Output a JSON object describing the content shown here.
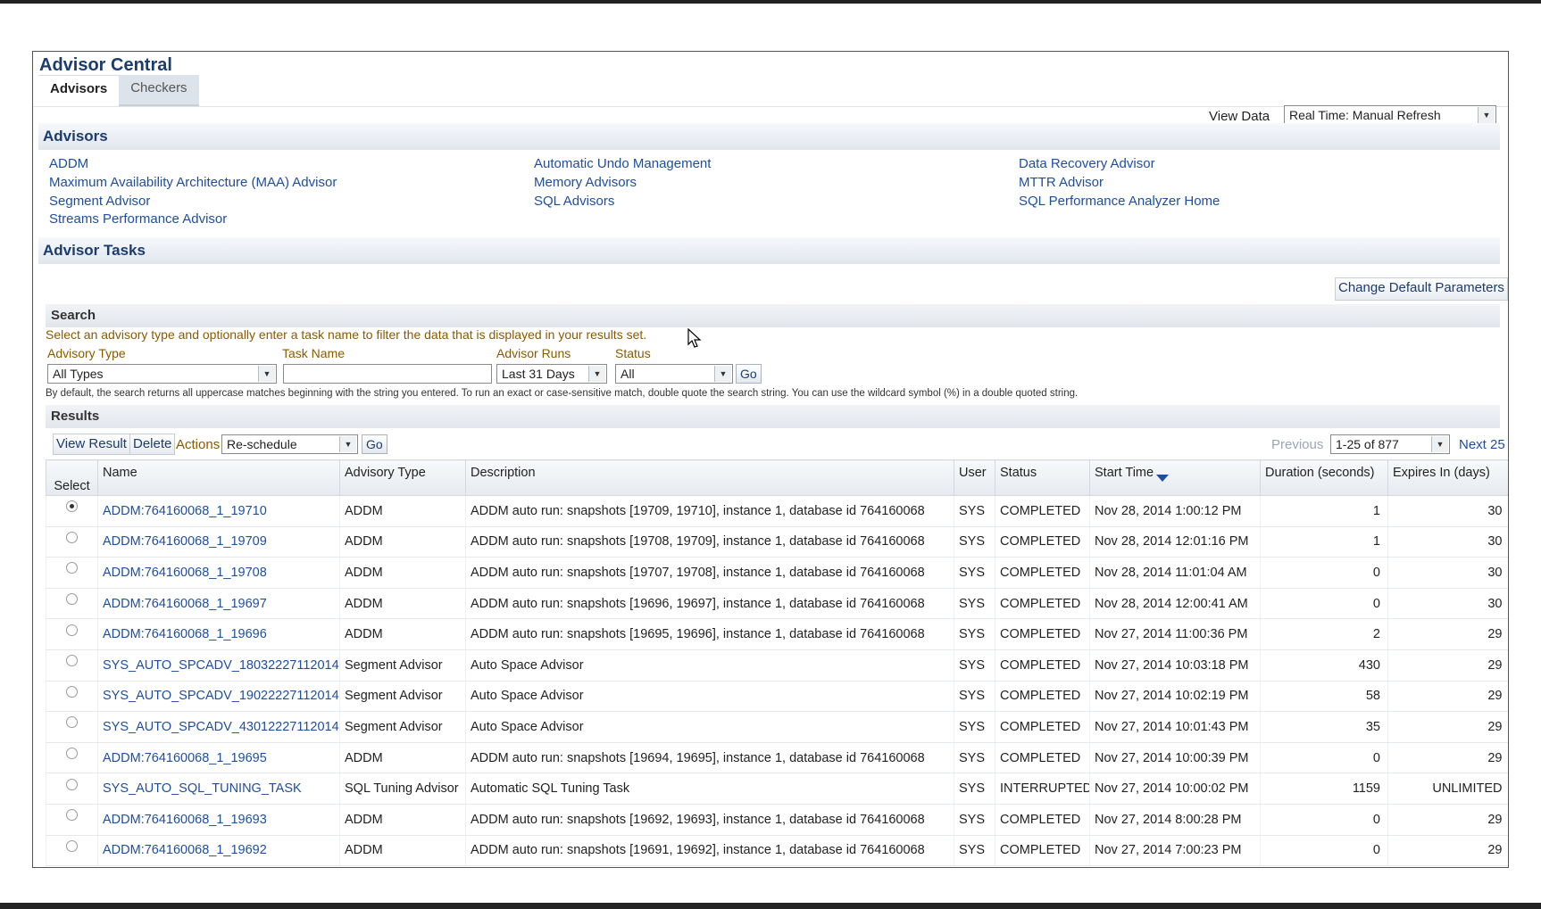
{
  "app": {
    "title": "Advisor Central"
  },
  "tabs": [
    {
      "label": "Advisors",
      "active": true
    },
    {
      "label": "Checkers",
      "active": false
    }
  ],
  "view_data": {
    "label": "View Data",
    "value": "Real Time: Manual Refresh"
  },
  "advisors_section": {
    "title": "Advisors",
    "columns": [
      [
        "ADDM",
        "Maximum Availability Architecture (MAA) Advisor",
        "Segment Advisor",
        "Streams Performance Advisor"
      ],
      [
        "Automatic Undo Management",
        "Memory Advisors",
        "SQL Advisors"
      ],
      [
        "Data Recovery Advisor",
        "MTTR Advisor",
        "SQL Performance Analyzer Home"
      ]
    ]
  },
  "tasks_section": {
    "title": "Advisor Tasks",
    "change_default_button": "Change Default Parameters"
  },
  "search": {
    "title": "Search",
    "instruction": "Select an advisory type and optionally enter a task name to filter the data that is displayed in your results set.",
    "advisory_type": {
      "label": "Advisory Type",
      "value": "All Types"
    },
    "task_name": {
      "label": "Task Name",
      "value": ""
    },
    "advisor_runs": {
      "label": "Advisor Runs",
      "value": "Last 31 Days"
    },
    "status": {
      "label": "Status",
      "value": "All"
    },
    "go_label": "Go",
    "hint": "By default, the search returns all uppercase matches beginning with the string you entered. To run an exact or case-sensitive match, double quote the search string. You can use the wildcard symbol (%) in a double quoted string."
  },
  "results": {
    "title": "Results",
    "view_result_button": "View Result",
    "delete_button": "Delete",
    "actions_label": "Actions",
    "actions_value": "Re-schedule",
    "go_label": "Go",
    "previous_label": "Previous",
    "range_value": "1-25 of 877",
    "next_label": "Next 25",
    "columns": [
      "Select",
      "Name",
      "Advisory Type",
      "Description",
      "User",
      "Status",
      "Start Time",
      "Duration (seconds)",
      "Expires In (days)"
    ],
    "rows": [
      {
        "selected": true,
        "name": "ADDM:764160068_1_19710",
        "type": "ADDM",
        "description": "ADDM auto run: snapshots [19709, 19710], instance 1, database id 764160068",
        "user": "SYS",
        "status": "COMPLETED",
        "start": "Nov 28, 2014 1:00:12 PM",
        "duration": "1",
        "expires": "30"
      },
      {
        "selected": false,
        "name": "ADDM:764160068_1_19709",
        "type": "ADDM",
        "description": "ADDM auto run: snapshots [19708, 19709], instance 1, database id 764160068",
        "user": "SYS",
        "status": "COMPLETED",
        "start": "Nov 28, 2014 12:01:16 PM",
        "duration": "1",
        "expires": "30"
      },
      {
        "selected": false,
        "name": "ADDM:764160068_1_19708",
        "type": "ADDM",
        "description": "ADDM auto run: snapshots [19707, 19708], instance 1, database id 764160068",
        "user": "SYS",
        "status": "COMPLETED",
        "start": "Nov 28, 2014 11:01:04 AM",
        "duration": "0",
        "expires": "30"
      },
      {
        "selected": false,
        "name": "ADDM:764160068_1_19697",
        "type": "ADDM",
        "description": "ADDM auto run: snapshots [19696, 19697], instance 1, database id 764160068",
        "user": "SYS",
        "status": "COMPLETED",
        "start": "Nov 28, 2014 12:00:41 AM",
        "duration": "0",
        "expires": "30"
      },
      {
        "selected": false,
        "name": "ADDM:764160068_1_19696",
        "type": "ADDM",
        "description": "ADDM auto run: snapshots [19695, 19696], instance 1, database id 764160068",
        "user": "SYS",
        "status": "COMPLETED",
        "start": "Nov 27, 2014 11:00:36 PM",
        "duration": "2",
        "expires": "29"
      },
      {
        "selected": false,
        "name": "SYS_AUTO_SPCADV_18032227112014",
        "type": "Segment Advisor",
        "description": "Auto Space Advisor",
        "user": "SYS",
        "status": "COMPLETED",
        "start": "Nov 27, 2014 10:03:18 PM",
        "duration": "430",
        "expires": "29"
      },
      {
        "selected": false,
        "name": "SYS_AUTO_SPCADV_19022227112014",
        "type": "Segment Advisor",
        "description": "Auto Space Advisor",
        "user": "SYS",
        "status": "COMPLETED",
        "start": "Nov 27, 2014 10:02:19 PM",
        "duration": "58",
        "expires": "29"
      },
      {
        "selected": false,
        "name": "SYS_AUTO_SPCADV_43012227112014",
        "type": "Segment Advisor",
        "description": "Auto Space Advisor",
        "user": "SYS",
        "status": "COMPLETED",
        "start": "Nov 27, 2014 10:01:43 PM",
        "duration": "35",
        "expires": "29"
      },
      {
        "selected": false,
        "name": "ADDM:764160068_1_19695",
        "type": "ADDM",
        "description": "ADDM auto run: snapshots [19694, 19695], instance 1, database id 764160068",
        "user": "SYS",
        "status": "COMPLETED",
        "start": "Nov 27, 2014 10:00:39 PM",
        "duration": "0",
        "expires": "29"
      },
      {
        "selected": false,
        "name": "SYS_AUTO_SQL_TUNING_TASK",
        "type": "SQL Tuning Advisor",
        "description": "Automatic SQL Tuning Task",
        "user": "SYS",
        "status": "INTERRUPTED",
        "start": "Nov 27, 2014 10:00:02 PM",
        "duration": "1159",
        "expires": "UNLIMITED"
      },
      {
        "selected": false,
        "name": "ADDM:764160068_1_19693",
        "type": "ADDM",
        "description": "ADDM auto run: snapshots [19692, 19693], instance 1, database id 764160068",
        "user": "SYS",
        "status": "COMPLETED",
        "start": "Nov 27, 2014 8:00:28 PM",
        "duration": "0",
        "expires": "29"
      },
      {
        "selected": false,
        "name": "ADDM:764160068_1_19692",
        "type": "ADDM",
        "description": "ADDM auto run: snapshots [19691, 19692], instance 1, database id 764160068",
        "user": "SYS",
        "status": "COMPLETED",
        "start": "Nov 27, 2014 7:00:23 PM",
        "duration": "0",
        "expires": "29"
      }
    ]
  },
  "colors": {
    "title": "#1a3c6e",
    "link": "#1f4e9c",
    "label": "#8a5a00"
  }
}
